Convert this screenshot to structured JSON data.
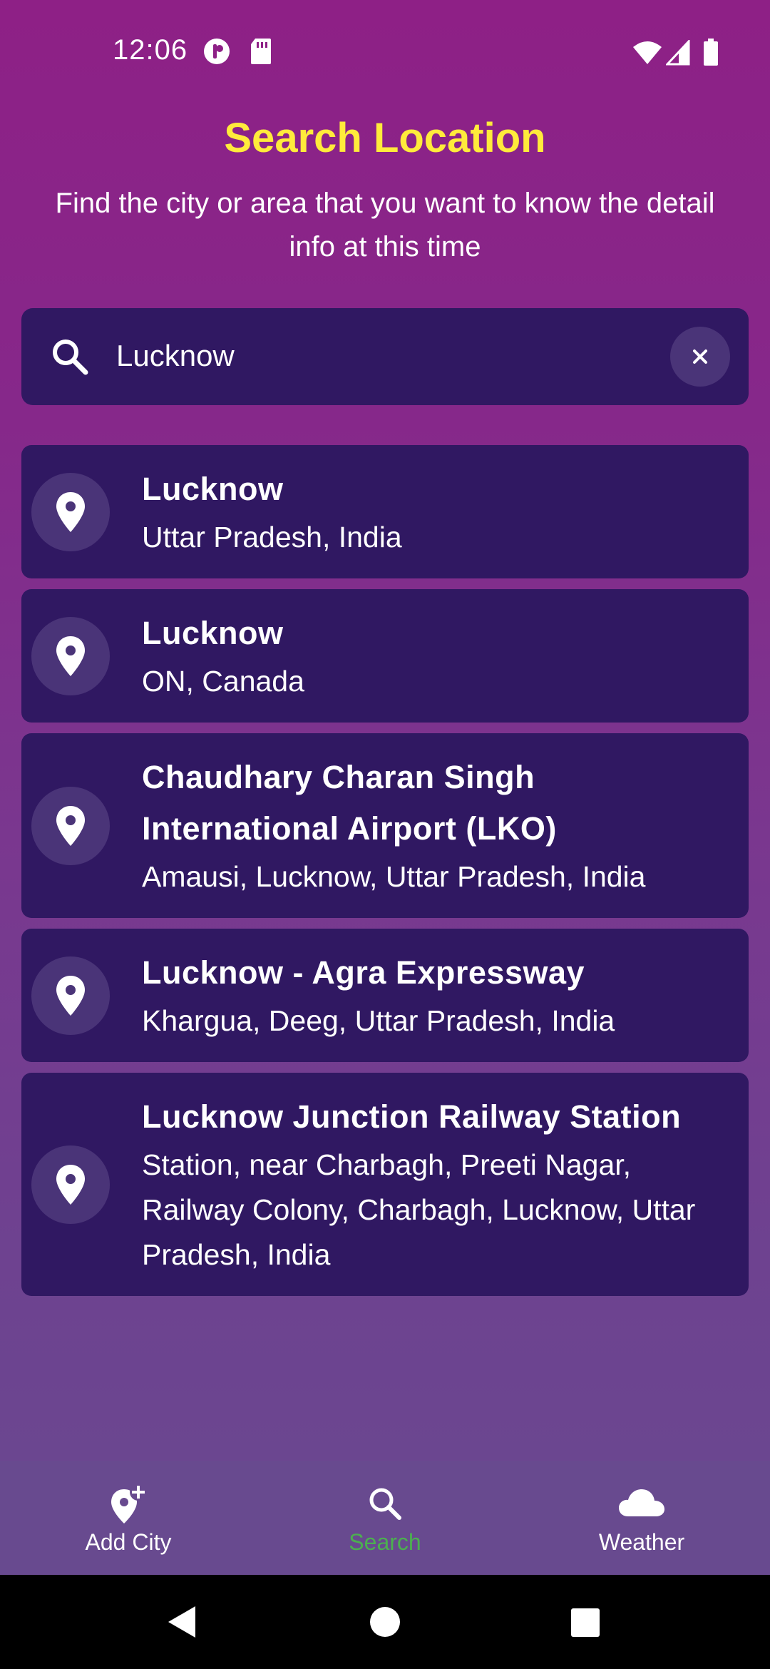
{
  "status_bar": {
    "time": "12:06"
  },
  "header": {
    "title": "Search Location",
    "subtitle": "Find the city or area that you want to know the detail info at this time"
  },
  "search": {
    "value": "Lucknow"
  },
  "results": [
    {
      "name": "Lucknow",
      "address": "Uttar Pradesh, India"
    },
    {
      "name": "Lucknow",
      "address": "ON, Canada"
    },
    {
      "name": "Chaudhary Charan Singh International Airport (LKO)",
      "address": "Amausi, Lucknow, Uttar Pradesh, India"
    },
    {
      "name": "Lucknow - Agra Expressway",
      "address": "Khargua, Deeg, Uttar Pradesh, India"
    },
    {
      "name": "Lucknow Junction Railway Station",
      "address": "Station, near Charbagh, Preeti Nagar, Railway Colony, Charbagh, Lucknow, Uttar Pradesh, India"
    }
  ],
  "bottom_nav": [
    {
      "label": "Add City",
      "icon": "add-location-icon",
      "active": false
    },
    {
      "label": "Search",
      "icon": "search-icon",
      "active": true
    },
    {
      "label": "Weather",
      "icon": "cloud-icon",
      "active": false
    }
  ],
  "colors": {
    "title": "#ffeb3b",
    "card": "#301862",
    "nav_active": "#4caf50",
    "nav_inactive": "#ffffff"
  }
}
